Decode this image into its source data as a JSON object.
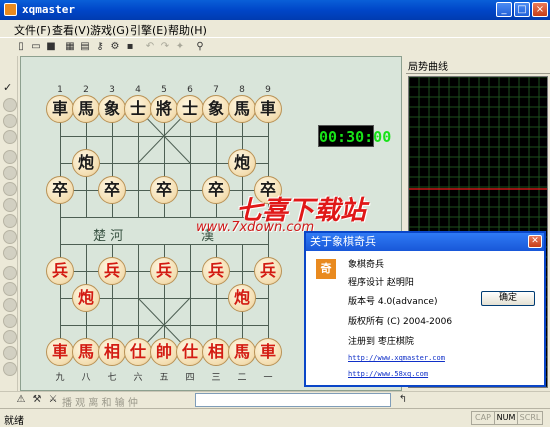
{
  "window": {
    "title": "xqmaster"
  },
  "menu": [
    "文件(F)",
    "查看(V)",
    "游戏(G)",
    "引擎(E)",
    "帮助(H)"
  ],
  "board": {
    "file_numbers_top": [
      "1",
      "2",
      "3",
      "4",
      "5",
      "6",
      "7",
      "8",
      "9"
    ],
    "file_numbers_bottom": [
      "九",
      "八",
      "七",
      "六",
      "五",
      "四",
      "三",
      "二",
      "一"
    ],
    "river_left": "楚 河",
    "river_right": "漢",
    "black_back_row": [
      "車",
      "馬",
      "象",
      "士",
      "將",
      "士",
      "象",
      "馬",
      "車"
    ],
    "black_cannon": "炮",
    "black_pawn": "卒",
    "red_pawn": "兵",
    "red_cannon": "炮",
    "red_back_row": [
      "車",
      "馬",
      "相",
      "仕",
      "帥",
      "仕",
      "相",
      "馬",
      "車"
    ]
  },
  "clock": "00:30:00",
  "right_panel": {
    "header": "局势曲线"
  },
  "notation_hint": "播 观 离 和 输 仲",
  "status": {
    "left": "就绪",
    "indicators": [
      "CAP",
      "NUM",
      "SCRL"
    ],
    "active": "NUM"
  },
  "dialog": {
    "title": "关于象棋奇兵",
    "icon_glyph": "奇",
    "product": "象棋奇兵",
    "author": "程序设计 赵明阳",
    "version": "版本号 4.0(advance)",
    "copyright": "版权所有 (C) 2004-2006",
    "registered": "注册到  枣庄棋院",
    "link1": "http://www.xqmaster.com",
    "link2": "http://www.58xq.com",
    "ok_label": "确定"
  },
  "watermark": {
    "text": "七喜下载站",
    "url": "www.7xdown.com"
  },
  "colors": {
    "titlebar": "#0046c8",
    "red_piece": "#d31b12",
    "clock": "#18e218",
    "chart_line": "#c81818"
  }
}
